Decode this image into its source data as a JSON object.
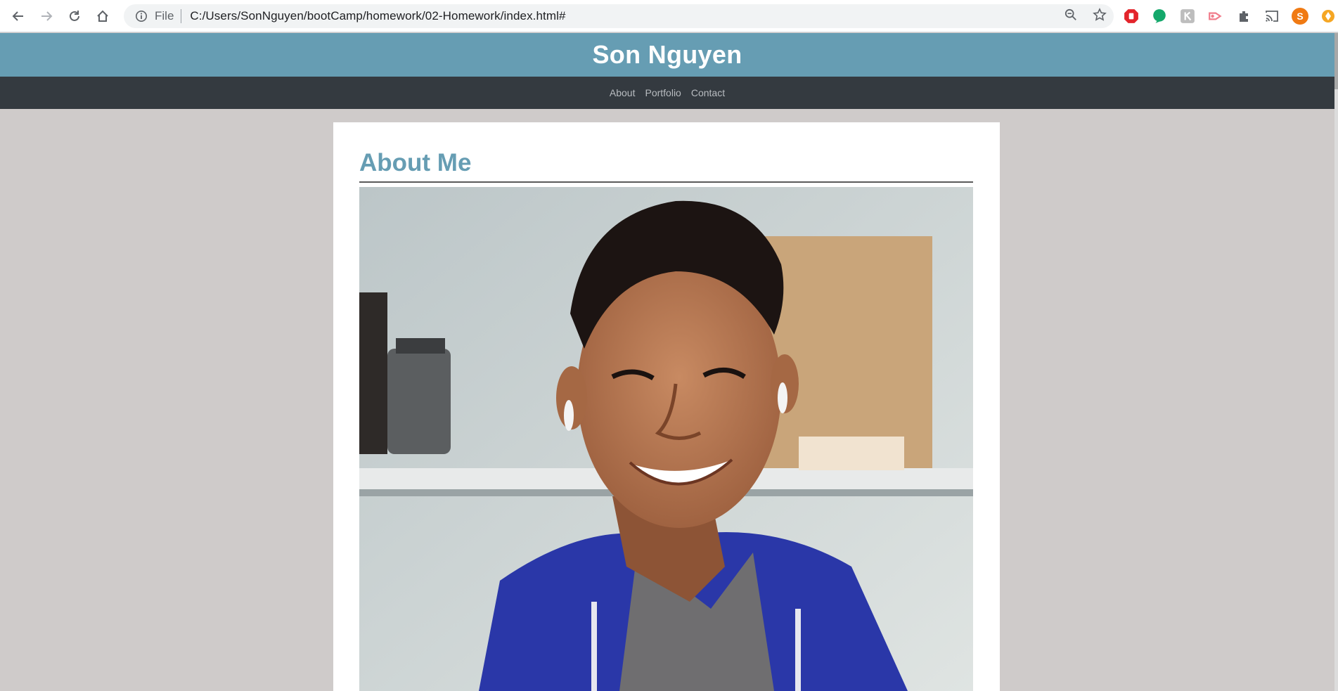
{
  "browser": {
    "scheme_label": "File",
    "url": "C:/Users/SonNguyen/bootCamp/homework/02-Homework/index.html#",
    "icons": [
      "back-icon",
      "forward-icon",
      "reload-icon",
      "home-icon",
      "info-icon",
      "zoom-icon",
      "star-icon",
      "extensions-icon",
      "cast-icon"
    ],
    "profile_initial": "S"
  },
  "site": {
    "title": "Son Nguyen",
    "nav": [
      "About",
      "Portfolio",
      "Contact"
    ]
  },
  "about": {
    "heading": "About Me"
  },
  "colors": {
    "header": "#669db3",
    "nav": "#343a40",
    "background": "#cfcbca",
    "heading": "#669db3"
  }
}
